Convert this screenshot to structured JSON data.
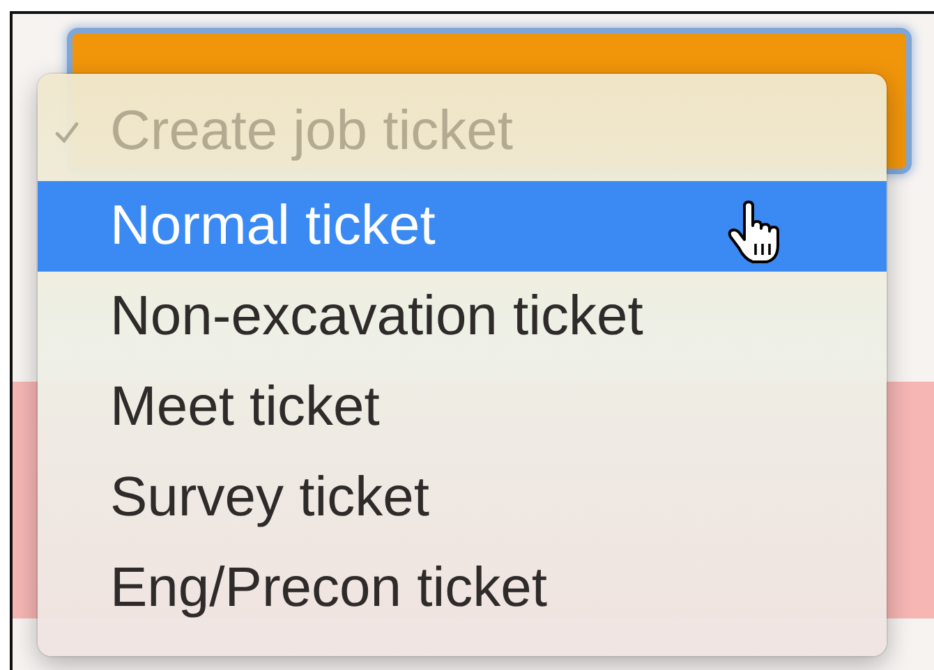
{
  "menu": {
    "items": [
      {
        "label": "Create job ticket",
        "checked": true,
        "disabled": true,
        "selected": false
      },
      {
        "label": "Normal ticket",
        "checked": false,
        "disabled": false,
        "selected": true
      },
      {
        "label": "Non-excavation ticket",
        "checked": false,
        "disabled": false,
        "selected": false
      },
      {
        "label": "Meet ticket",
        "checked": false,
        "disabled": false,
        "selected": false
      },
      {
        "label": "Survey ticket",
        "checked": false,
        "disabled": false,
        "selected": false
      },
      {
        "label": "Eng/Precon ticket",
        "checked": false,
        "disabled": false,
        "selected": false
      }
    ]
  }
}
